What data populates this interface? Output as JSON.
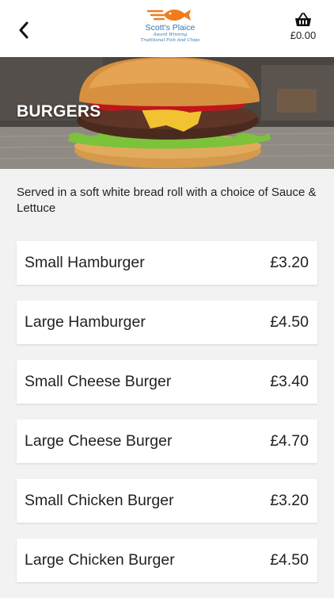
{
  "header": {
    "logo": {
      "name": "Scott's Plaice",
      "tagline_1": "Award Winning",
      "tagline_2": "Traditional Fish And Chips"
    },
    "cart_total": "£0.00",
    "icons": {
      "back": "chevron-left-icon",
      "cart": "basket-icon"
    }
  },
  "hero": {
    "title": "BURGERS"
  },
  "description": "Served in a soft white bread roll with a choice of Sauce & Lettuce",
  "items": [
    {
      "name": "Small Hamburger",
      "price": "£3.20"
    },
    {
      "name": "Large Hamburger",
      "price": "£4.50"
    },
    {
      "name": "Small Cheese Burger",
      "price": "£3.40"
    },
    {
      "name": "Large Cheese Burger",
      "price": "£4.70"
    },
    {
      "name": "Small Chicken Burger",
      "price": "£3.20"
    },
    {
      "name": "Large Chicken Burger",
      "price": "£4.50"
    }
  ],
  "colors": {
    "brand_blue": "#2f79b8",
    "brand_orange": "#f07c1e",
    "background": "#f2f2f2",
    "card": "#ffffff"
  }
}
